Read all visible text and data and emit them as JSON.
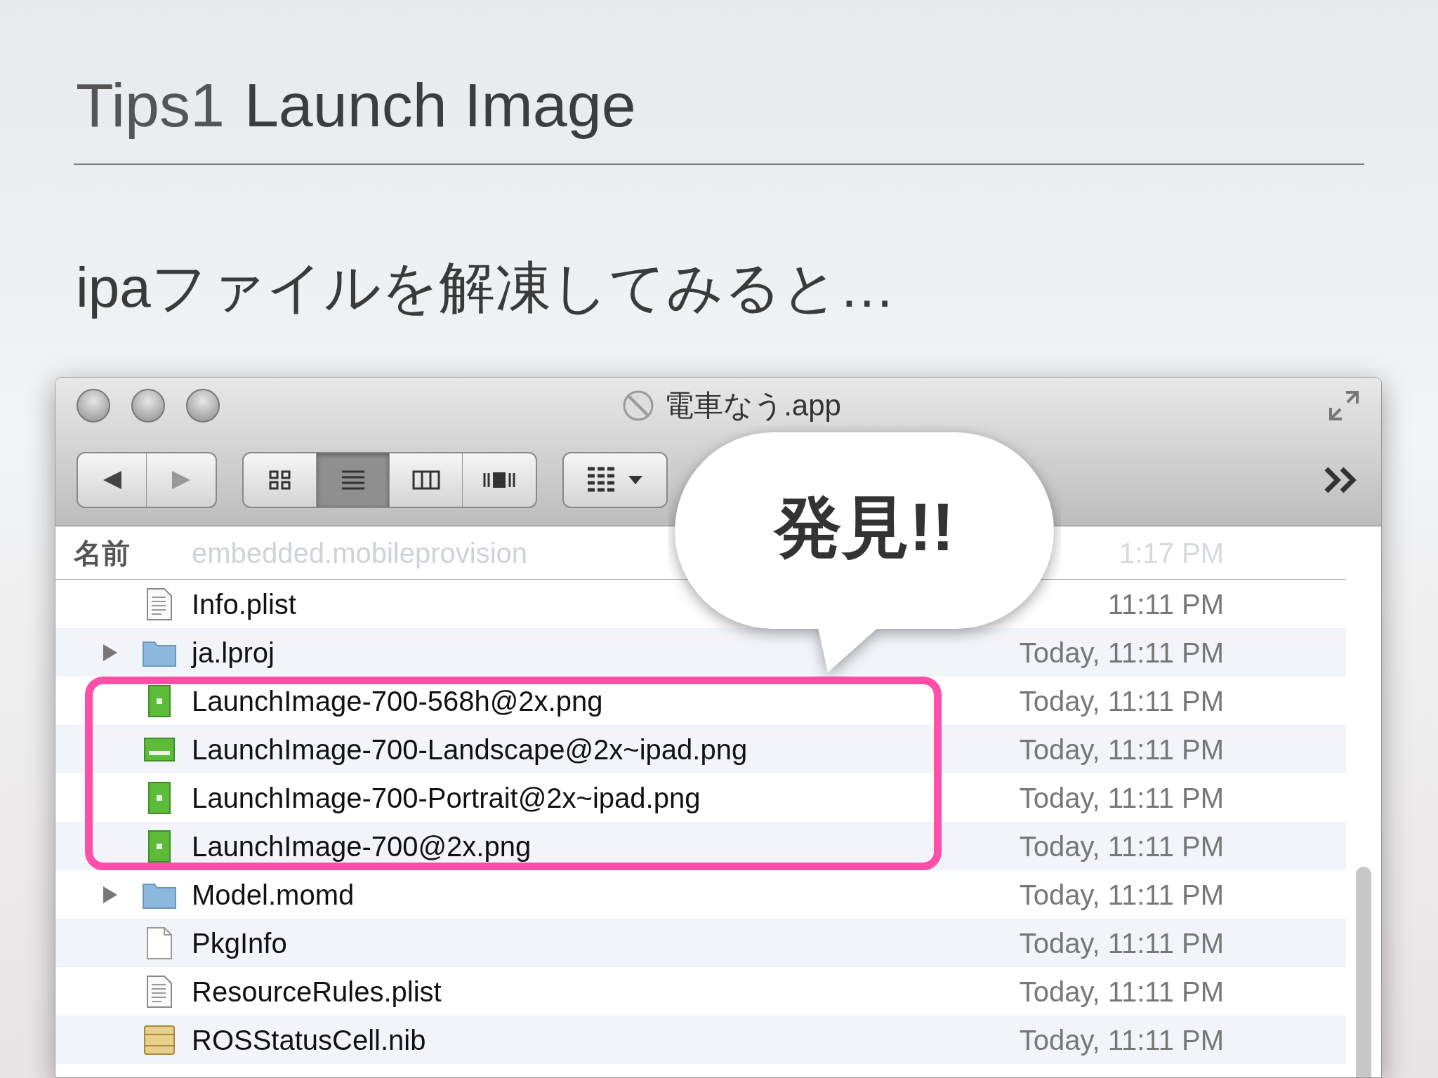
{
  "slide": {
    "title_prefix": "Tips1",
    "title": "Launch Image",
    "subtitle": "ipaファイルを解凍してみると…"
  },
  "window": {
    "title": "電車なう.app",
    "view_modes": [
      {
        "kind": "icon",
        "selected": false
      },
      {
        "kind": "list",
        "selected": true
      },
      {
        "kind": "column",
        "selected": false
      },
      {
        "kind": "coverflow",
        "selected": false
      }
    ]
  },
  "header": {
    "column_1": "名前",
    "faded_name": "embedded.mobileprovision",
    "faded_date": "1:17 PM"
  },
  "rows": [
    {
      "kind": "plist",
      "name": "Info.plist",
      "date": "11:11 PM",
      "highlighted": false
    },
    {
      "kind": "folder",
      "name": "ja.lproj",
      "date": "Today, 11:11 PM",
      "expanded": false,
      "highlighted": false
    },
    {
      "kind": "portrait",
      "name": "LaunchImage-700-568h@2x.png",
      "date": "Today, 11:11 PM",
      "highlighted": true
    },
    {
      "kind": "landscape",
      "name": "LaunchImage-700-Landscape@2x~ipad.png",
      "date": "Today, 11:11 PM",
      "highlighted": true
    },
    {
      "kind": "portrait",
      "name": "LaunchImage-700-Portrait@2x~ipad.png",
      "date": "Today, 11:11 PM",
      "highlighted": true
    },
    {
      "kind": "portrait",
      "name": "LaunchImage-700@2x.png",
      "date": "Today, 11:11 PM",
      "highlighted": true
    },
    {
      "kind": "folder",
      "name": "Model.momd",
      "date": "Today, 11:11 PM",
      "expanded": false,
      "highlighted": false
    },
    {
      "kind": "blank",
      "name": "PkgInfo",
      "date": "Today, 11:11 PM",
      "highlighted": false
    },
    {
      "kind": "plist",
      "name": "ResourceRules.plist",
      "date": "Today, 11:11 PM",
      "highlighted": false
    },
    {
      "kind": "nib",
      "name": "ROSStatusCell.nib",
      "date": "Today, 11:11 PM",
      "highlighted": false
    }
  ],
  "callout": {
    "text": "発見!!"
  }
}
